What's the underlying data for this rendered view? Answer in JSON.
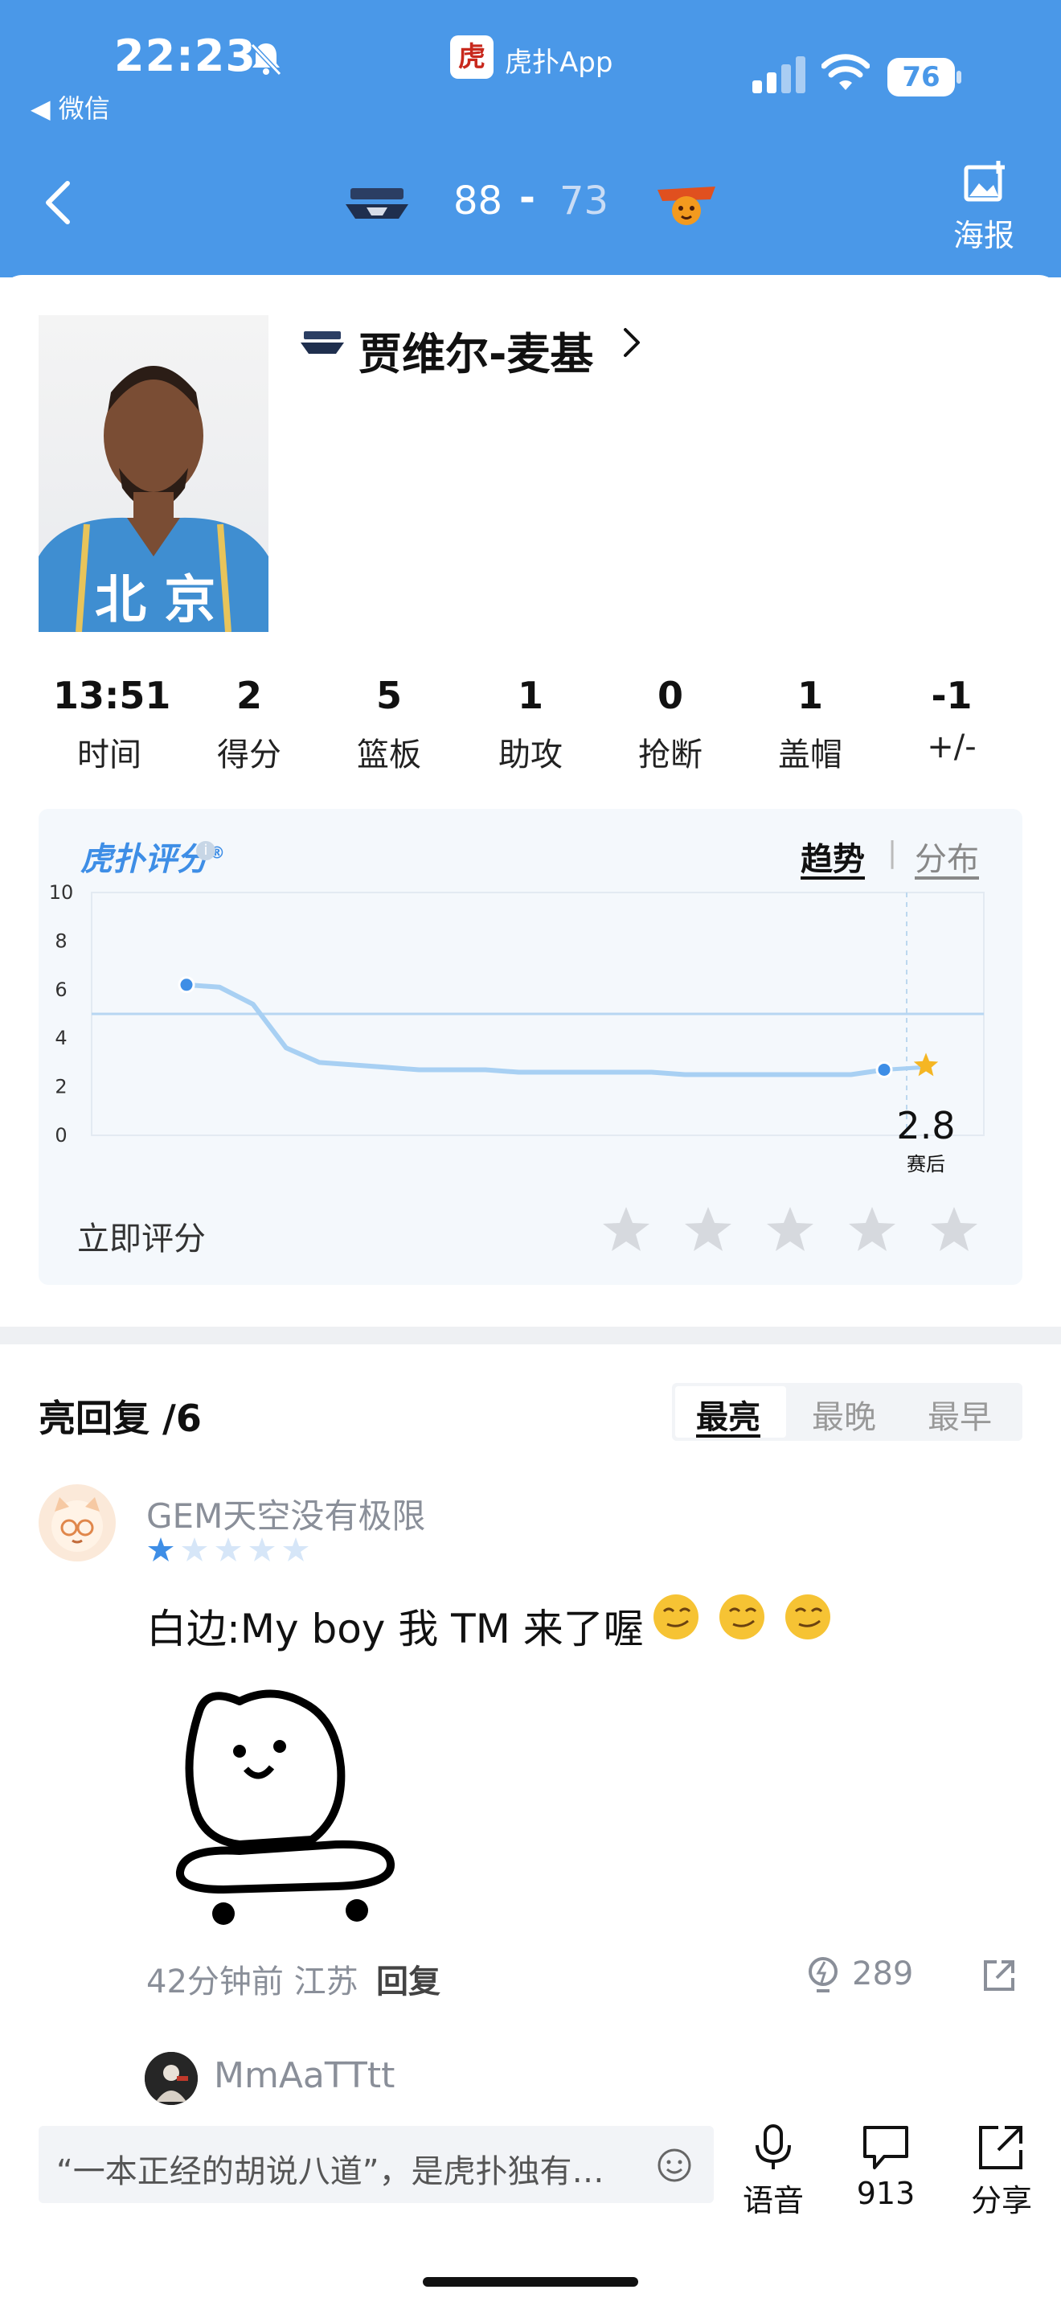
{
  "status_bar": {
    "time": "22:23",
    "back_app": "◀ 微信",
    "app_name": "虎扑App",
    "battery": "76"
  },
  "game_header": {
    "score_home": "88",
    "score_dash": "-",
    "score_away": "73",
    "poster_label": "海报"
  },
  "player": {
    "name": "贾维尔-麦基",
    "photo_text": "北 京"
  },
  "stats": [
    {
      "value": "13:51",
      "label": "时间"
    },
    {
      "value": "2",
      "label": "得分"
    },
    {
      "value": "5",
      "label": "篮板"
    },
    {
      "value": "1",
      "label": "助攻"
    },
    {
      "value": "0",
      "label": "抢断"
    },
    {
      "value": "1",
      "label": "盖帽"
    },
    {
      "value": "-1",
      "label": "+/-"
    }
  ],
  "rating": {
    "logo": "虎扑评分",
    "logo_mark": "®",
    "info": "i",
    "tab_trend": "趋势",
    "tab_separator": "|",
    "tab_distribution": "分布",
    "rate_now": "立即评分",
    "final_score": "2.8",
    "final_label": "赛后",
    "accent_color": "#4a98e8",
    "star_color": "#f5b623"
  },
  "chart_data": {
    "type": "line",
    "ylim": [
      0,
      10
    ],
    "yticks": [
      "0",
      "2",
      "4",
      "6",
      "8",
      "10"
    ],
    "reference_line": 5,
    "series": [
      {
        "values": [
          6.2,
          6.1,
          5.4,
          3.6,
          3.0,
          2.9,
          2.8,
          2.7,
          2.7,
          2.7,
          2.6,
          2.6,
          2.6,
          2.6,
          2.6,
          2.5,
          2.5,
          2.5,
          2.5,
          2.5,
          2.5,
          2.7,
          2.8
        ]
      }
    ],
    "final_value": 2.8,
    "final_label": "赛后"
  },
  "replies": {
    "title": "亮回复 /6",
    "sort_options": [
      "最亮",
      "最晚",
      "最早"
    ],
    "active_sort": "最亮",
    "items": [
      {
        "user": "GEM天空没有极限",
        "stars": 1,
        "text": "白边:My boy 我 TM 来了喔",
        "meta": "42分钟前 江苏",
        "reply_label": "回复",
        "likes": "289"
      },
      {
        "user": "MmAaTTtt"
      }
    ]
  },
  "bottom_bar": {
    "input_placeholder": "“一本正经的胡说八道”，是虎扑独有…",
    "voice_label": "语音",
    "comments_count": "913",
    "share_label": "分享"
  }
}
